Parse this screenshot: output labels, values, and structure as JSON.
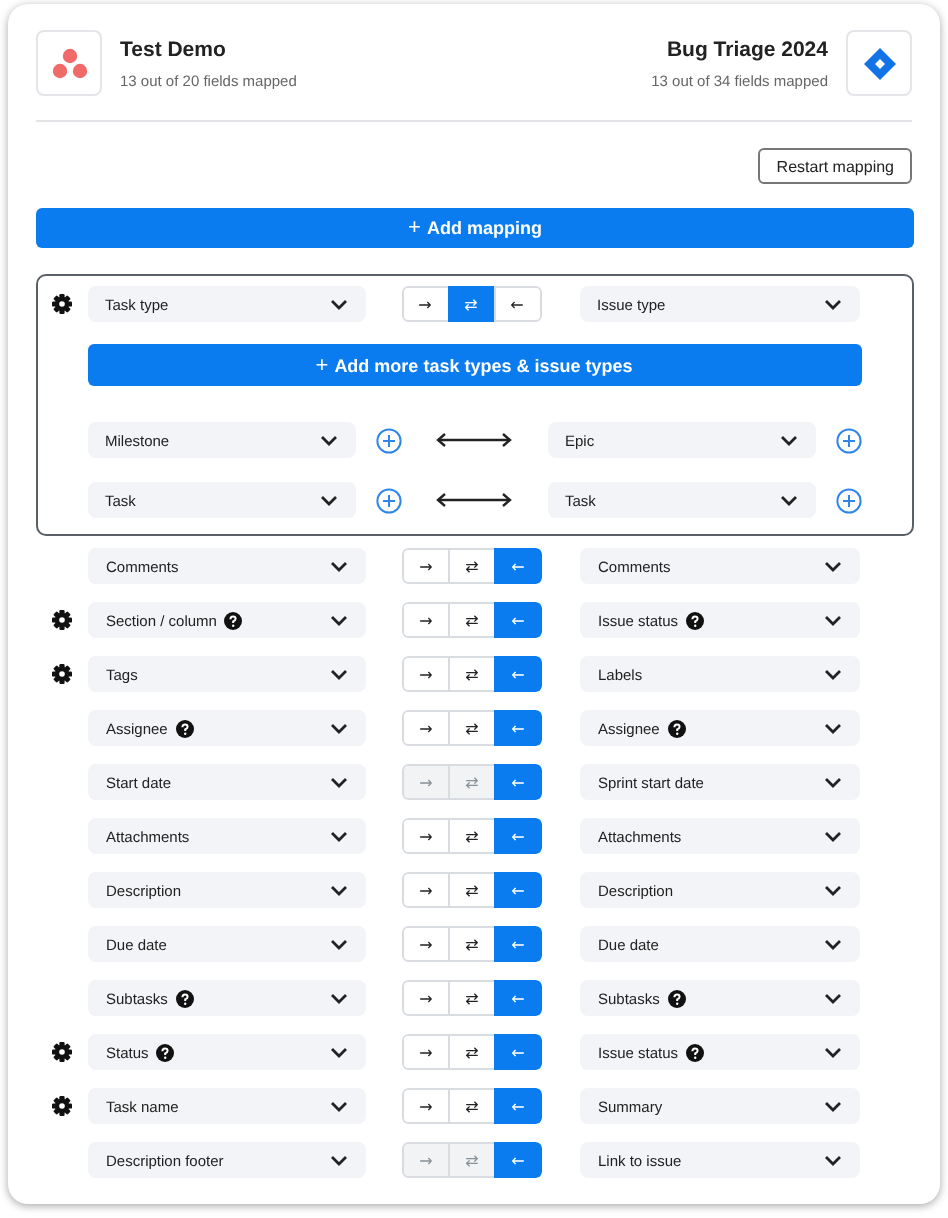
{
  "source": {
    "title": "Test Demo",
    "subtitle": "13 out of 20 fields mapped"
  },
  "target": {
    "title": "Bug Triage 2024",
    "subtitle": "13 out of 34 fields mapped"
  },
  "restart_button": "Restart mapping",
  "add_mapping_button": {
    "icon": "+",
    "label": "Add mapping"
  },
  "type_group": {
    "row": {
      "gear": true,
      "left": {
        "label": "Task type",
        "help": false
      },
      "right": {
        "label": "Issue type",
        "help": false
      },
      "directions": [
        {
          "arrow": "→",
          "selected": false,
          "disabled": false
        },
        {
          "arrow": "⇄",
          "selected": true,
          "disabled": false
        },
        {
          "arrow": "←",
          "selected": false,
          "disabled": false
        }
      ]
    },
    "add_more_button": {
      "icon": "+",
      "label": "Add more task types & issue types"
    },
    "pairs": [
      {
        "left": "Milestone",
        "right": "Epic"
      },
      {
        "left": "Task",
        "right": "Task"
      }
    ]
  },
  "rows": [
    {
      "gear": false,
      "left": {
        "label": "Comments",
        "help": false
      },
      "right": {
        "label": "Comments",
        "help": false
      },
      "directions": [
        {
          "arrow": "→",
          "selected": false,
          "disabled": false
        },
        {
          "arrow": "⇄",
          "selected": false,
          "disabled": false
        },
        {
          "arrow": "←",
          "selected": true,
          "disabled": false
        }
      ]
    },
    {
      "gear": true,
      "left": {
        "label": "Section / column",
        "help": true
      },
      "right": {
        "label": "Issue status",
        "help": true
      },
      "directions": [
        {
          "arrow": "→",
          "selected": false,
          "disabled": false
        },
        {
          "arrow": "⇄",
          "selected": false,
          "disabled": false
        },
        {
          "arrow": "←",
          "selected": true,
          "disabled": false
        }
      ]
    },
    {
      "gear": true,
      "left": {
        "label": "Tags",
        "help": false
      },
      "right": {
        "label": "Labels",
        "help": false
      },
      "directions": [
        {
          "arrow": "→",
          "selected": false,
          "disabled": false
        },
        {
          "arrow": "⇄",
          "selected": false,
          "disabled": false
        },
        {
          "arrow": "←",
          "selected": true,
          "disabled": false
        }
      ]
    },
    {
      "gear": false,
      "left": {
        "label": "Assignee",
        "help": true
      },
      "right": {
        "label": "Assignee",
        "help": true
      },
      "directions": [
        {
          "arrow": "→",
          "selected": false,
          "disabled": false
        },
        {
          "arrow": "⇄",
          "selected": false,
          "disabled": false
        },
        {
          "arrow": "←",
          "selected": true,
          "disabled": false
        }
      ]
    },
    {
      "gear": false,
      "left": {
        "label": "Start date",
        "help": false
      },
      "right": {
        "label": "Sprint start date",
        "help": false
      },
      "directions": [
        {
          "arrow": "→",
          "selected": false,
          "disabled": true
        },
        {
          "arrow": "⇄",
          "selected": false,
          "disabled": true
        },
        {
          "arrow": "←",
          "selected": true,
          "disabled": false
        }
      ]
    },
    {
      "gear": false,
      "left": {
        "label": "Attachments",
        "help": false
      },
      "right": {
        "label": "Attachments",
        "help": false
      },
      "directions": [
        {
          "arrow": "→",
          "selected": false,
          "disabled": false
        },
        {
          "arrow": "⇄",
          "selected": false,
          "disabled": false
        },
        {
          "arrow": "←",
          "selected": true,
          "disabled": false
        }
      ]
    },
    {
      "gear": false,
      "left": {
        "label": "Description",
        "help": false
      },
      "right": {
        "label": "Description",
        "help": false
      },
      "directions": [
        {
          "arrow": "→",
          "selected": false,
          "disabled": false
        },
        {
          "arrow": "⇄",
          "selected": false,
          "disabled": false
        },
        {
          "arrow": "←",
          "selected": true,
          "disabled": false
        }
      ]
    },
    {
      "gear": false,
      "left": {
        "label": "Due date",
        "help": false
      },
      "right": {
        "label": "Due date",
        "help": false
      },
      "directions": [
        {
          "arrow": "→",
          "selected": false,
          "disabled": false
        },
        {
          "arrow": "⇄",
          "selected": false,
          "disabled": false
        },
        {
          "arrow": "←",
          "selected": true,
          "disabled": false
        }
      ]
    },
    {
      "gear": false,
      "left": {
        "label": "Subtasks",
        "help": true
      },
      "right": {
        "label": "Subtasks",
        "help": true
      },
      "directions": [
        {
          "arrow": "→",
          "selected": false,
          "disabled": false
        },
        {
          "arrow": "⇄",
          "selected": false,
          "disabled": false
        },
        {
          "arrow": "←",
          "selected": true,
          "disabled": false
        }
      ]
    },
    {
      "gear": true,
      "left": {
        "label": "Status",
        "help": true
      },
      "right": {
        "label": "Issue status",
        "help": true
      },
      "directions": [
        {
          "arrow": "→",
          "selected": false,
          "disabled": false
        },
        {
          "arrow": "⇄",
          "selected": false,
          "disabled": false
        },
        {
          "arrow": "←",
          "selected": true,
          "disabled": false
        }
      ]
    },
    {
      "gear": true,
      "left": {
        "label": "Task name",
        "help": false
      },
      "right": {
        "label": "Summary",
        "help": false
      },
      "directions": [
        {
          "arrow": "→",
          "selected": false,
          "disabled": false
        },
        {
          "arrow": "⇄",
          "selected": false,
          "disabled": false
        },
        {
          "arrow": "←",
          "selected": true,
          "disabled": false
        }
      ]
    },
    {
      "gear": false,
      "left": {
        "label": "Description footer",
        "help": false
      },
      "right": {
        "label": "Link to issue",
        "help": false
      },
      "directions": [
        {
          "arrow": "→",
          "selected": false,
          "disabled": true
        },
        {
          "arrow": "⇄",
          "selected": false,
          "disabled": true
        },
        {
          "arrow": "←",
          "selected": true,
          "disabled": false
        }
      ]
    }
  ]
}
